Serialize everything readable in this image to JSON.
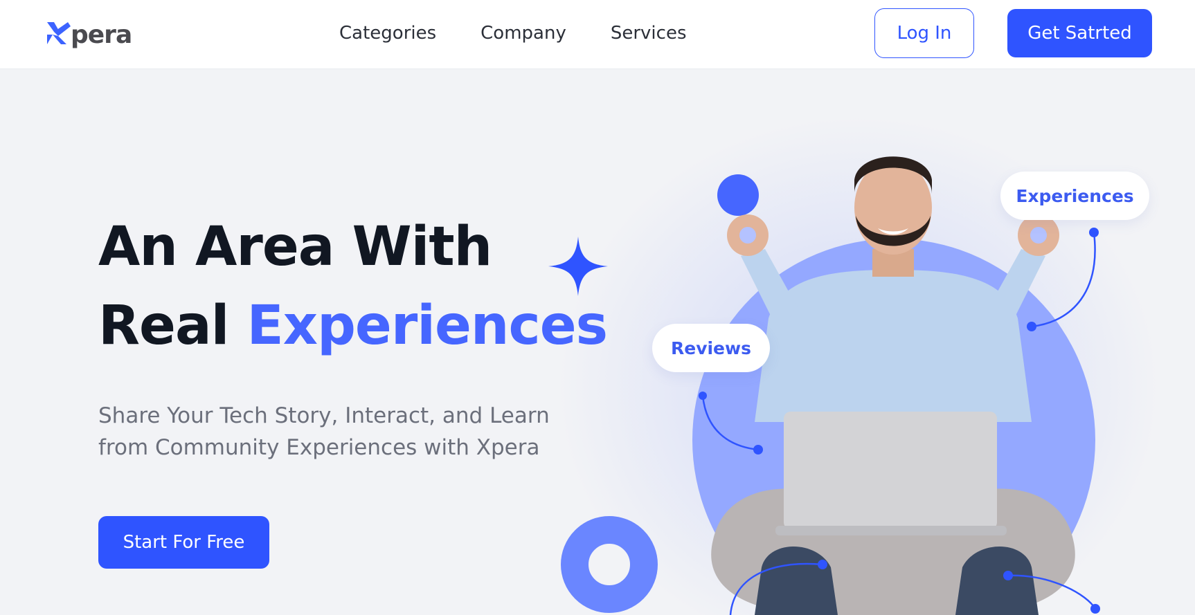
{
  "brand": {
    "name": "pera",
    "mark_color": "#3c63ff",
    "text_color": "#4a4a4f"
  },
  "nav": {
    "items": [
      "Categories",
      "Company",
      "Services"
    ]
  },
  "header": {
    "login_label": "Log In",
    "get_started_label": "Get Satrted"
  },
  "hero": {
    "title_line1": "An Area With",
    "title_line2_plain": "Real",
    "title_line2_accent": "Experiences",
    "subtitle": "Share Your Tech Story, Interact, and Learn from Community Experiences with Xpera",
    "cta_label": "Start For Free"
  },
  "tags": {
    "reviews": "Reviews",
    "experiences": "Experiences"
  },
  "colors": {
    "accent": "#2f54ff",
    "accent_text": "#4666ff",
    "heading": "#111722",
    "body_text": "#6b6f7b",
    "background": "#f2f3f6"
  },
  "icons": {
    "logo": "xpera-logo-icon",
    "decoration_star": "sparkle-star-icon"
  }
}
